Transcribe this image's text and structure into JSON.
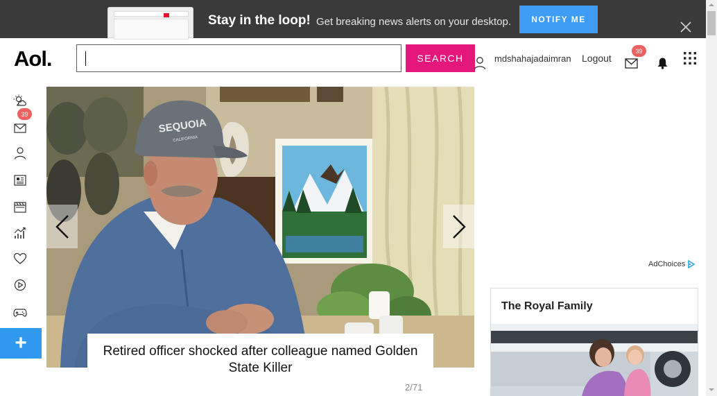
{
  "banner": {
    "title": "Stay in the loop!",
    "subtitle": "Get breaking news alerts on your desktop.",
    "notify_label": "NOTIFY ME",
    "close_icon": "close-icon",
    "accent_color": "#3e9cf5"
  },
  "header": {
    "logo": "Aol.",
    "search": {
      "value": "",
      "placeholder": ""
    },
    "search_label": "SEARCH",
    "search_color": "#e5177b",
    "username": "mdshahajadaimran",
    "logout_label": "Logout",
    "mail_count": "39"
  },
  "sidebar": {
    "items": [
      {
        "name": "weather",
        "icon": "weather-icon"
      },
      {
        "name": "mail",
        "icon": "mail-icon",
        "badge": "39"
      },
      {
        "name": "profile",
        "icon": "user-icon"
      },
      {
        "name": "news",
        "icon": "newspaper-icon"
      },
      {
        "name": "entertainment",
        "icon": "clapperboard-icon"
      },
      {
        "name": "finance",
        "icon": "chart-icon"
      },
      {
        "name": "lifestyle",
        "icon": "heart-icon"
      },
      {
        "name": "video",
        "icon": "play-icon"
      },
      {
        "name": "games",
        "icon": "gamepad-icon"
      }
    ],
    "plus_label": "+"
  },
  "slideshow": {
    "caption": "Retired officer shocked after colleague named Golden State Killer",
    "counter": "2/71",
    "cap_text": "SEQUOIA",
    "cap_subtext": "CALIFORNIA"
  },
  "right": {
    "adchoices_label": "AdChoices",
    "card_title": "The Royal Family"
  }
}
